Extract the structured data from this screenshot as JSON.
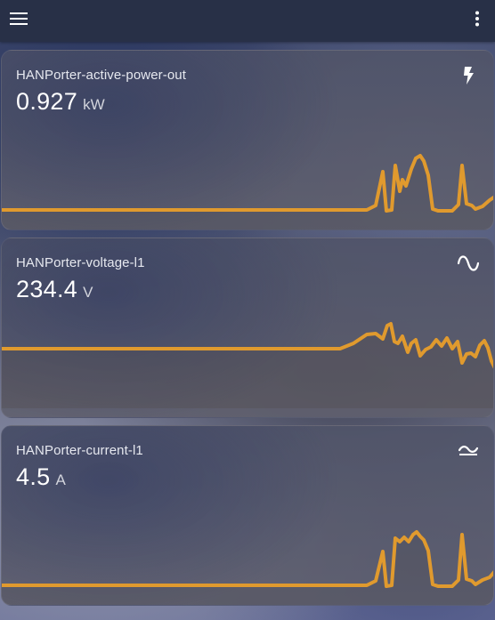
{
  "topbar": {
    "menu_icon": "hamburger-menu-icon",
    "more_icon": "more-vertical-icon"
  },
  "colors": {
    "topbar": "#283047",
    "line": "#e09a2e",
    "text": "#ffffff"
  },
  "cards": [
    {
      "name": "HANPorter-active-power-out",
      "value": "0.927",
      "unit": "kW",
      "icon": "lightning-bolt-icon"
    },
    {
      "name": "HANPorter-voltage-l1",
      "value": "234.4",
      "unit": "V",
      "icon": "sine-wave-icon"
    },
    {
      "name": "HANPorter-current-l1",
      "value": "4.5",
      "unit": "A",
      "icon": "current-ac-icon"
    }
  ]
}
